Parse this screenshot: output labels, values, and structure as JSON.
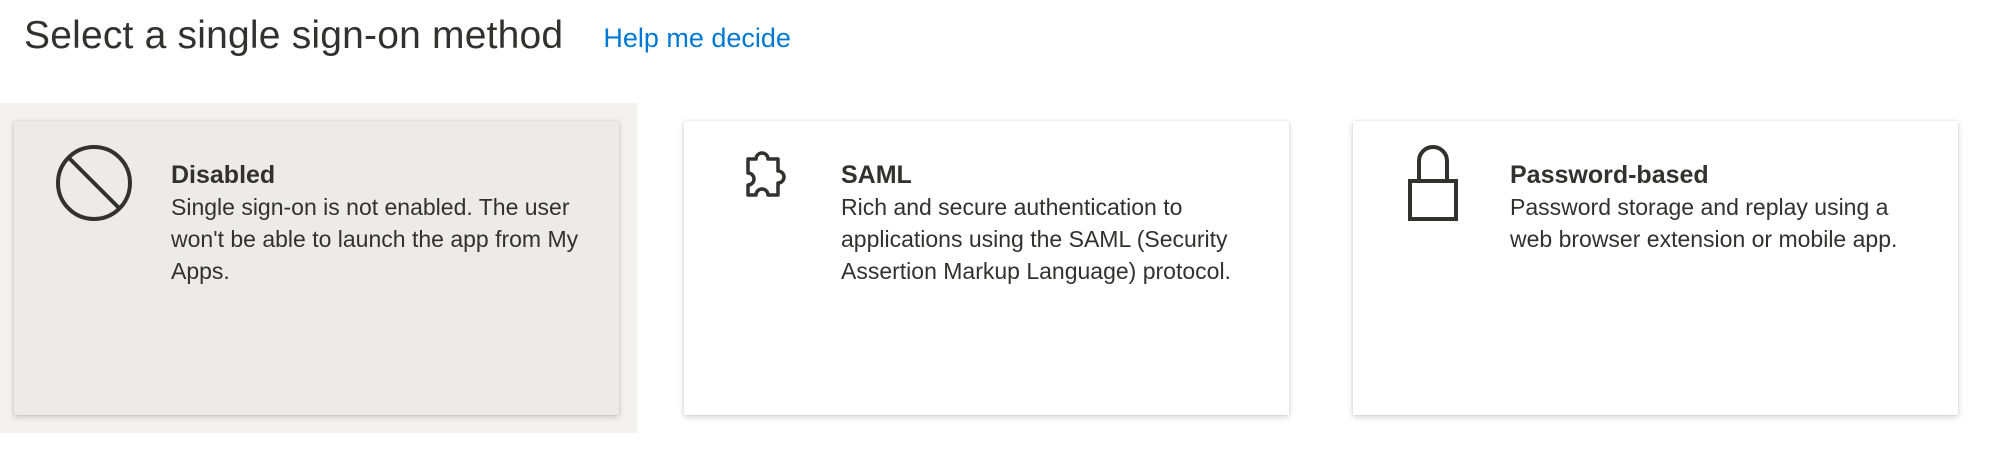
{
  "header": {
    "title": "Select a single sign-on method",
    "help_link": "Help me decide"
  },
  "methods": [
    {
      "title": "Disabled",
      "description": "Single sign-on is not enabled. The user won't be able to launch the app from My Apps.",
      "icon": "disabled-icon",
      "selected": true
    },
    {
      "title": "SAML",
      "description": "Rich and secure authentication to applications using the SAML (Security Assertion Markup Language) protocol.",
      "icon": "puzzle-icon",
      "selected": false
    },
    {
      "title": "Password-based",
      "description": "Password storage and replay using a web browser extension or mobile app.",
      "icon": "lock-icon",
      "selected": false
    }
  ],
  "colors": {
    "link": "#0078d4",
    "text": "#323130",
    "selected_card": "#edebe9",
    "selected_highlight": "#f3f2f1"
  }
}
